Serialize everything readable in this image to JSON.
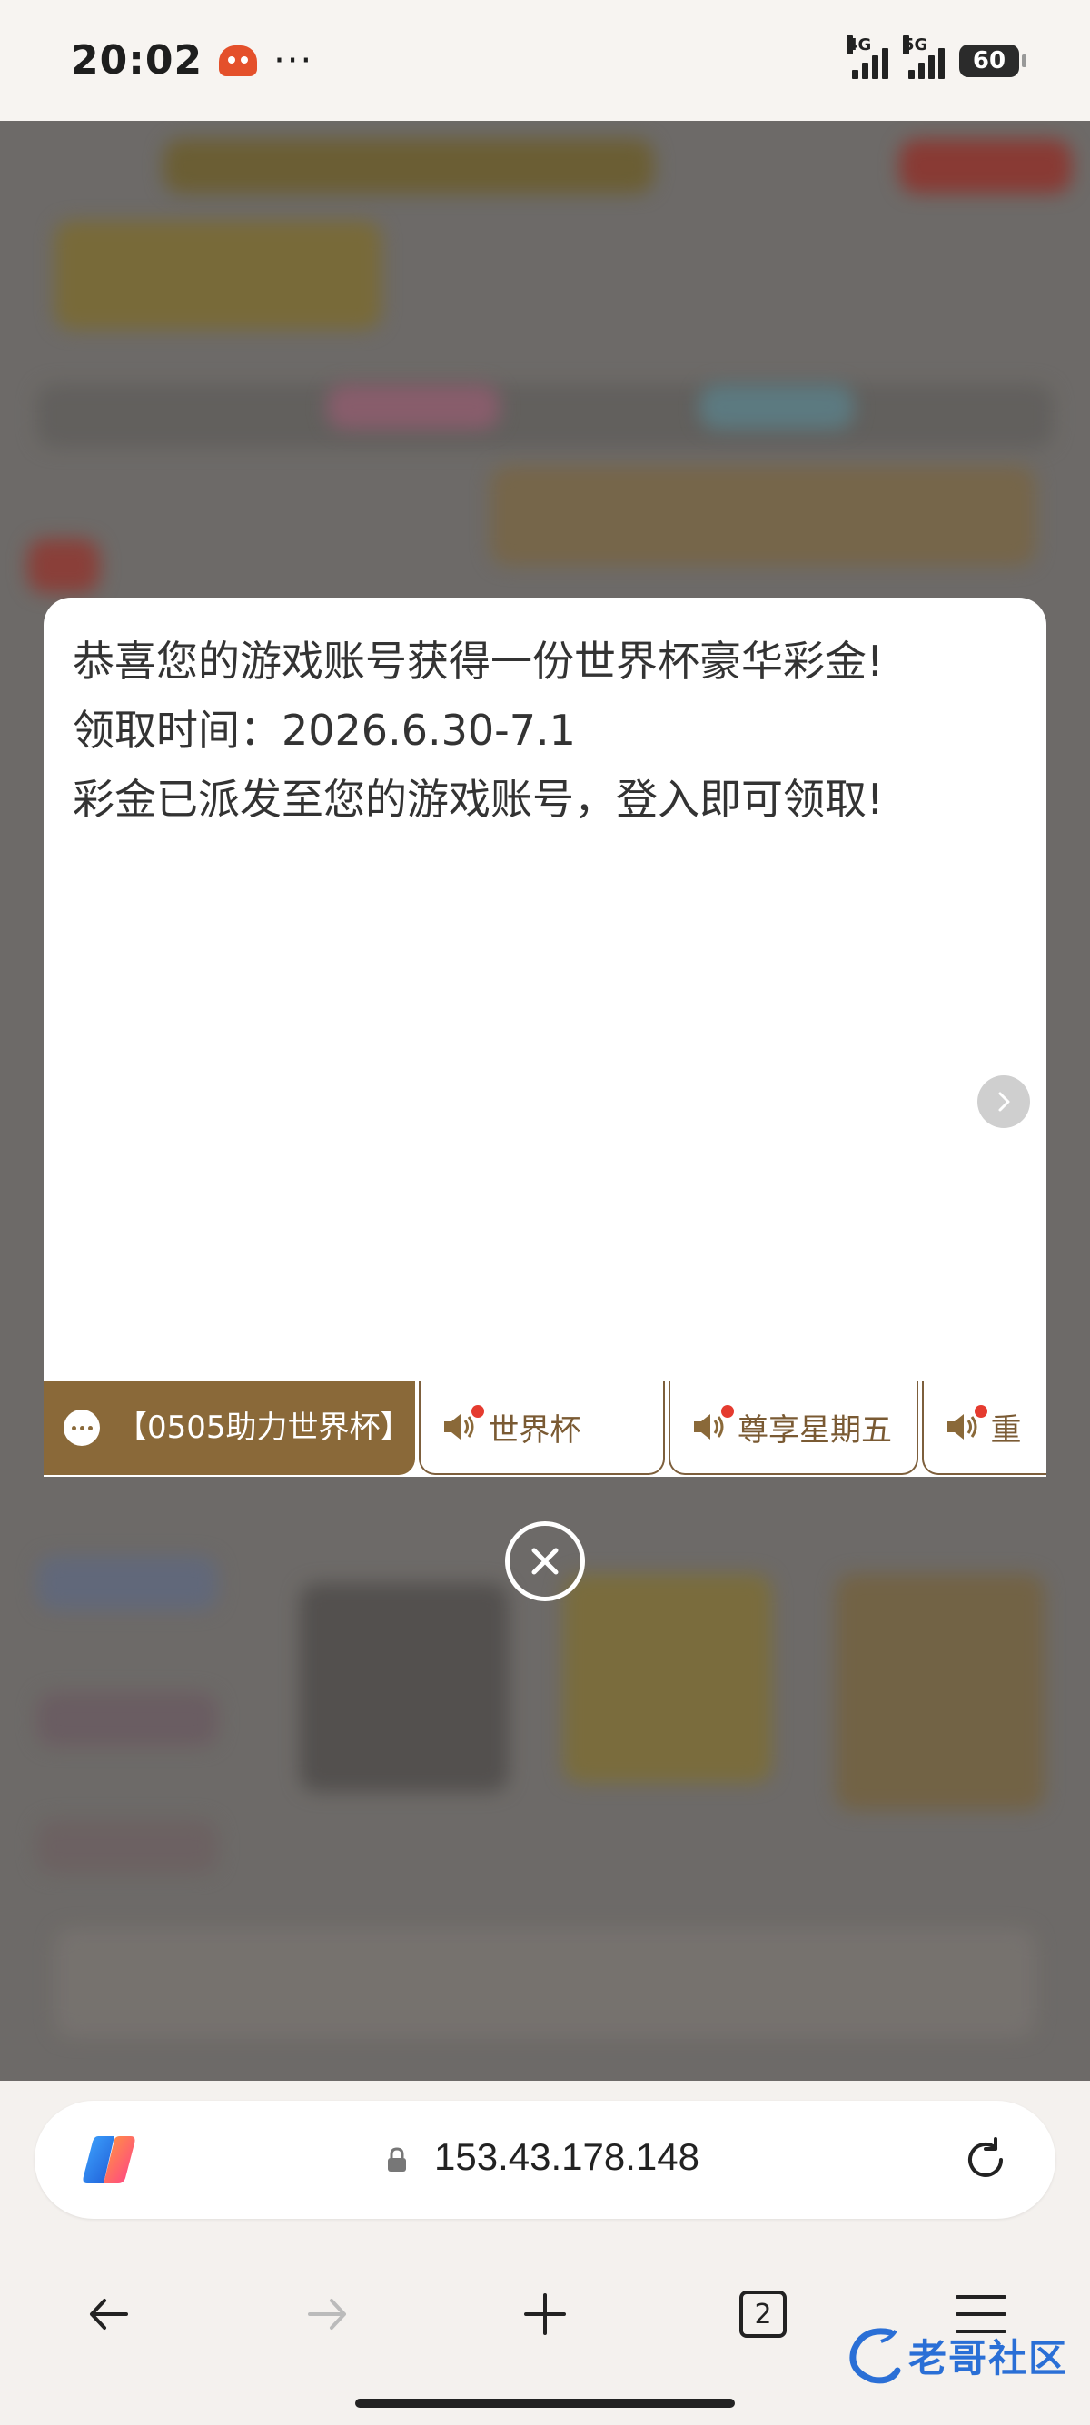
{
  "status_bar": {
    "time": "20:02",
    "more": "···",
    "network1": "4G",
    "network2": "5G",
    "battery": "60"
  },
  "dialog": {
    "lines": [
      "恭喜您的游戏账号获得一份世界杯豪华彩金!",
      "领取时间：2026.6.30-7.1",
      "彩金已派发至您的游戏账号，登入即可领取!"
    ],
    "tabs": [
      {
        "label": "【0505助力世界杯】",
        "active": true
      },
      {
        "label": "世界杯",
        "active": false
      },
      {
        "label": "尊享星期五",
        "active": false
      },
      {
        "label": "重",
        "active": false
      }
    ]
  },
  "browser": {
    "url": "153.43.178.148",
    "tab_count": "2"
  },
  "watermark": {
    "text": "老哥社区"
  },
  "colors": {
    "accent": "#8a6939",
    "notification_dot": "#e53b2f"
  }
}
